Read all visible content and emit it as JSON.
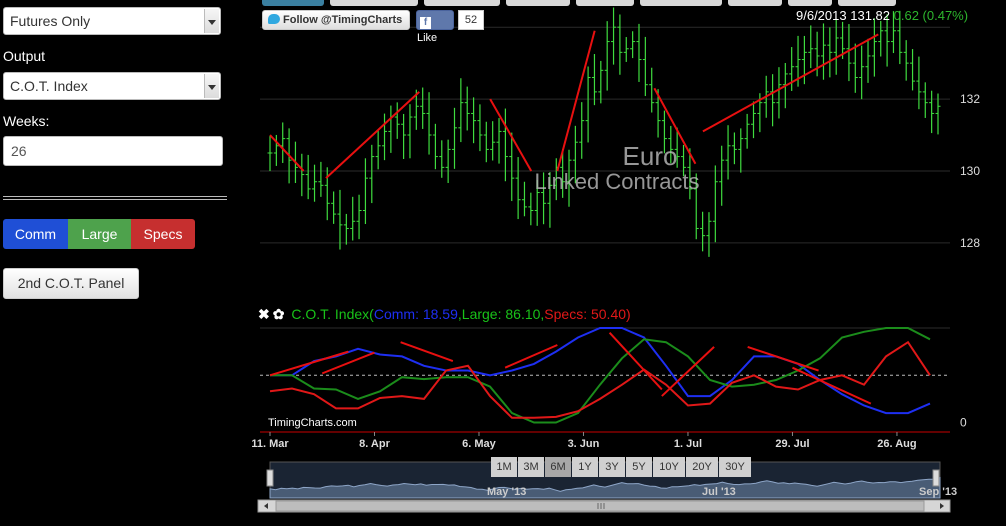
{
  "controls": {
    "contract_type": "Futures Only",
    "output_label": "Output",
    "output_value": "C.O.T. Index",
    "weeks_label": "Weeks:",
    "weeks_value": "26",
    "buttons": [
      {
        "label": "Comm",
        "color": "#1f4fd6"
      },
      {
        "label": "Large",
        "color": "#4ea24c"
      },
      {
        "label": "Specs",
        "color": "#c62f2f"
      }
    ],
    "panel_button": "2nd C.O.T. Panel"
  },
  "social": {
    "twitter_label": "Follow @TimingCharts",
    "like_label": "Like",
    "like_count": "52"
  },
  "quote": {
    "date": "9/6/2013",
    "price": "131.82",
    "change": "0.62 (0.47%)"
  },
  "watermark": {
    "line1": "Euro",
    "line2": "Linked Contracts"
  },
  "cot": {
    "icons": [
      "close-icon",
      "gear-icon"
    ],
    "name": "C.O.T. Index",
    "comm": "Comm: 18.59",
    "large": "Large: 86.10",
    "specs": "Specs: 50.40"
  },
  "brand": "TimingCharts.com",
  "range_buttons": [
    "1M",
    "3M",
    "6M",
    "1Y",
    "3Y",
    "5Y",
    "10Y",
    "20Y",
    "30Y"
  ],
  "navigator": {
    "labels": [
      "May '13",
      "Jul '13",
      "Sep '13"
    ]
  },
  "chart_data": [
    {
      "type": "ohlc",
      "title": "",
      "x_axis": [
        "11. Mar",
        "8. Apr",
        "6. May",
        "3. Jun",
        "1. Jul",
        "29. Jul",
        "26. Aug"
      ],
      "y_ticks": [
        "128",
        "130",
        "132"
      ],
      "ylim": [
        127.3,
        134.2
      ],
      "series_color": "#3fdc3f",
      "closes": [
        130.5,
        130.7,
        130.9,
        130.3,
        130.1,
        129.9,
        129.5,
        129.7,
        129.6,
        129.1,
        128.8,
        128.5,
        128.4,
        128.6,
        128.9,
        129.8,
        130.4,
        130.7,
        131.1,
        131.5,
        131.3,
        131.0,
        131.5,
        131.8,
        131.6,
        131.0,
        130.4,
        130.1,
        130.6,
        131.2,
        131.9,
        131.6,
        131.4,
        131.0,
        130.6,
        130.8,
        131.1,
        130.4,
        129.8,
        129.2,
        129.0,
        128.9,
        129.4,
        129.1,
        129.6,
        130.1,
        129.7,
        130.3,
        130.8,
        131.4,
        132.6,
        132.2,
        132.8,
        133.6,
        134.0,
        133.3,
        133.4,
        133.6,
        133.1,
        132.4,
        131.9,
        131.4,
        130.9,
        130.6,
        130.4,
        130.1,
        129.5,
        128.4,
        128.2,
        128.6,
        129.7,
        130.3,
        130.7,
        130.6,
        130.9,
        131.3,
        131.6,
        131.9,
        132.2,
        131.9,
        132.4,
        132.7,
        132.9,
        133.1,
        133.3,
        133.4,
        133.2,
        133.5,
        133.3,
        133.7,
        133.4,
        133.0,
        132.6,
        132.9,
        133.2,
        133.6,
        133.9,
        133.6,
        133.9,
        133.3,
        133.0,
        132.5,
        132.2,
        131.9,
        131.6,
        131.8
      ],
      "trend_lines": [
        {
          "from": [
            "11. Mar",
            131.0
          ],
          "to": [
            "20. Mar",
            130.0
          ]
        },
        {
          "from": [
            "26. Mar",
            129.8
          ],
          "to": [
            "20. Apr",
            132.2
          ]
        },
        {
          "from": [
            "9. May",
            132.0
          ],
          "to": [
            "20. May",
            130.0
          ]
        },
        {
          "from": [
            "27. May",
            130.0
          ],
          "to": [
            "6. Jun",
            133.9
          ]
        },
        {
          "from": [
            "22. Jun",
            132.3
          ],
          "to": [
            "3. Jul",
            130.2
          ]
        },
        {
          "from": [
            "5. Jul",
            131.1
          ],
          "to": [
            "21. Aug",
            133.8
          ]
        }
      ]
    },
    {
      "type": "line",
      "title": "C.O.T. Index",
      "y_ticks": [
        "0"
      ],
      "ylim": [
        -10,
        100
      ],
      "reference_line": 50,
      "series": [
        {
          "name": "Comm",
          "color": "#1e2ff2",
          "values": [
            50,
            50,
            65,
            70,
            78,
            72,
            70,
            60,
            55,
            55,
            50,
            55,
            62,
            75,
            90,
            100,
            100,
            90,
            60,
            28,
            28,
            45,
            70,
            70,
            62,
            45,
            30,
            18,
            10,
            10,
            20
          ]
        },
        {
          "name": "Large",
          "color": "#1b8c1b",
          "values": [
            50,
            50,
            36,
            35,
            25,
            33,
            48,
            46,
            48,
            48,
            38,
            10,
            0,
            0,
            10,
            40,
            68,
            88,
            85,
            70,
            45,
            38,
            40,
            45,
            55,
            68,
            90,
            96,
            100,
            100,
            88
          ]
        },
        {
          "name": "Specs",
          "color": "#e01818",
          "values": [
            33,
            36,
            30,
            15,
            15,
            26,
            28,
            25,
            55,
            60,
            28,
            5,
            5,
            6,
            12,
            25,
            40,
            56,
            40,
            18,
            20,
            42,
            50,
            38,
            35,
            45,
            50,
            40,
            70,
            85,
            50
          ]
        }
      ],
      "trend_lines": [
        {
          "from": [
            "11. Mar",
            50
          ],
          "to": [
            "1. Apr",
            75
          ]
        },
        {
          "from": [
            "25. Mar",
            52
          ],
          "to": [
            "8. Apr",
            74
          ]
        },
        {
          "from": [
            "15. Apr",
            85
          ],
          "to": [
            "29. Apr",
            65
          ]
        },
        {
          "from": [
            "13. May",
            58
          ],
          "to": [
            "27. May",
            82
          ]
        },
        {
          "from": [
            "10. Jun",
            95
          ],
          "to": [
            "24. Jun",
            35
          ]
        },
        {
          "from": [
            "24. Jun",
            28
          ],
          "to": [
            "8. Jul",
            80
          ]
        },
        {
          "from": [
            "17. Jul",
            80
          ],
          "to": [
            "5. Aug",
            55
          ]
        },
        {
          "from": [
            "29. Jul",
            58
          ],
          "to": [
            "19. Aug",
            20
          ]
        }
      ]
    }
  ]
}
